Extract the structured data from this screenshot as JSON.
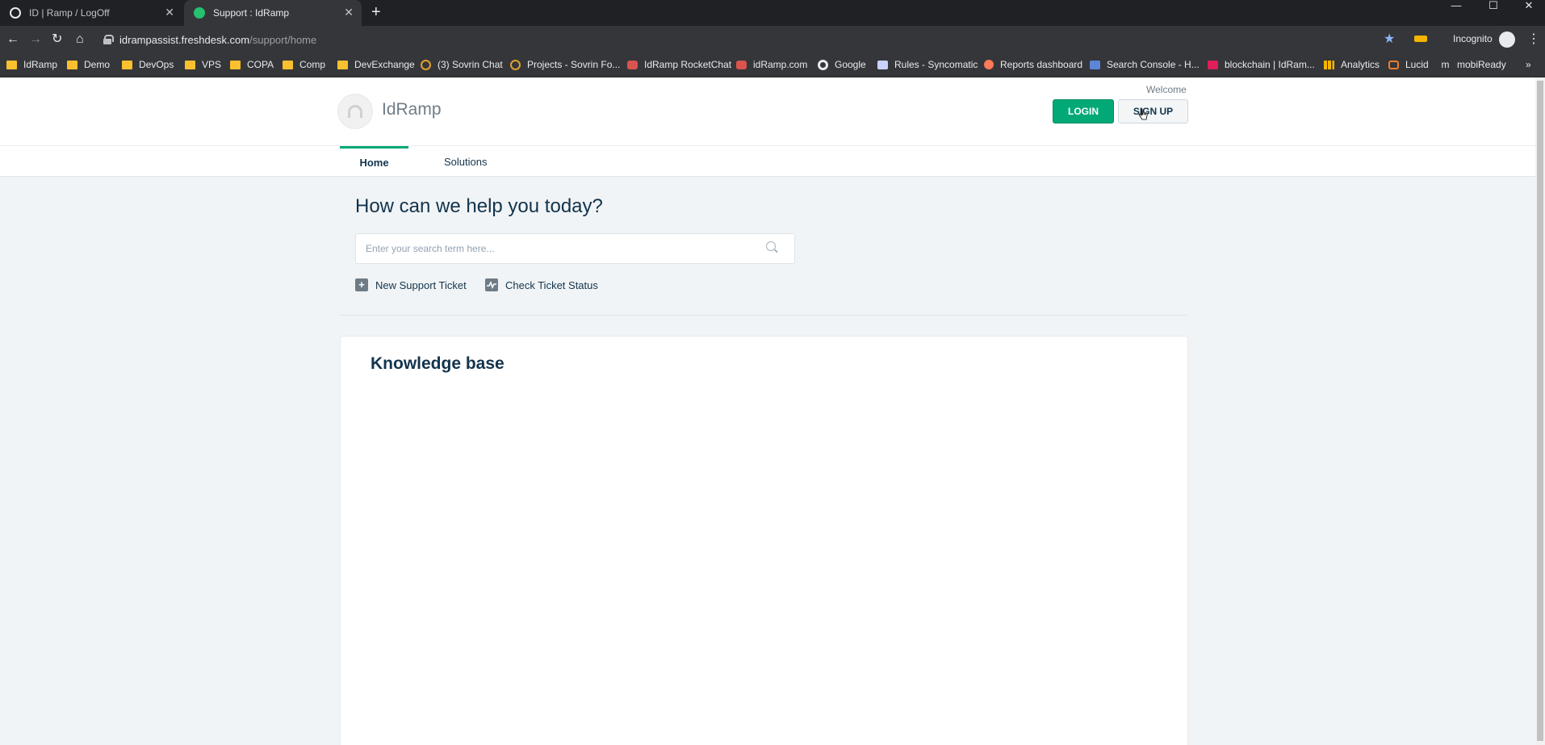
{
  "browser": {
    "tabs": [
      {
        "title": "ID | Ramp / LogOff",
        "active": false
      },
      {
        "title": "Support : IdRamp",
        "active": true
      }
    ],
    "new_tab": "+",
    "url_host": "idrampassist.freshdesk.com",
    "url_path": "/support/home",
    "incognito_label": "Incognito",
    "bookmarks": [
      {
        "label": "IdRamp",
        "icon": "folder-icon"
      },
      {
        "label": "Demo",
        "icon": "folder-icon"
      },
      {
        "label": "DevOps",
        "icon": "folder-icon"
      },
      {
        "label": "VPS",
        "icon": "folder-icon"
      },
      {
        "label": "COPA",
        "icon": "folder-icon"
      },
      {
        "label": "Comp",
        "icon": "folder-icon"
      },
      {
        "label": "DevExchange",
        "icon": "folder-icon"
      },
      {
        "label": "(3) Sovrin Chat",
        "icon": "sovrin-icon"
      },
      {
        "label": "Projects - Sovrin Fo...",
        "icon": "sovrin-icon"
      },
      {
        "label": "IdRamp RocketChat",
        "icon": "rocketchat-icon"
      },
      {
        "label": "idRamp.com",
        "icon": "idramp-icon"
      },
      {
        "label": "Google",
        "icon": "google-icon"
      },
      {
        "label": "Rules - Syncomatic",
        "icon": "doc-icon"
      },
      {
        "label": "Reports dashboard",
        "icon": "hubspot-icon"
      },
      {
        "label": "Search Console - H...",
        "icon": "search-console-icon"
      },
      {
        "label": "blockchain | IdRam...",
        "icon": "slack-icon"
      },
      {
        "label": "Analytics",
        "icon": "analytics-icon"
      },
      {
        "label": "Lucid",
        "icon": "lucid-icon"
      },
      {
        "label": "mobiReady",
        "icon": "mobiready-icon"
      }
    ]
  },
  "header": {
    "brand": "IdRamp",
    "welcome": "Welcome",
    "login_label": "LOGIN",
    "signup_label": "SIGN UP"
  },
  "nav": {
    "tabs": [
      {
        "label": "Home",
        "active": true
      },
      {
        "label": "Solutions",
        "active": false
      }
    ]
  },
  "hero": {
    "title": "How can we help you today?",
    "search_placeholder": "Enter your search term here..."
  },
  "actions": {
    "new_ticket": "New Support Ticket",
    "check_status": "Check Ticket Status"
  },
  "knowledge_base": {
    "title": "Knowledge base"
  },
  "colors": {
    "accent": "#02a977",
    "text": "#12344d",
    "muted": "#6f7c87",
    "background": "#f1f4f6"
  }
}
